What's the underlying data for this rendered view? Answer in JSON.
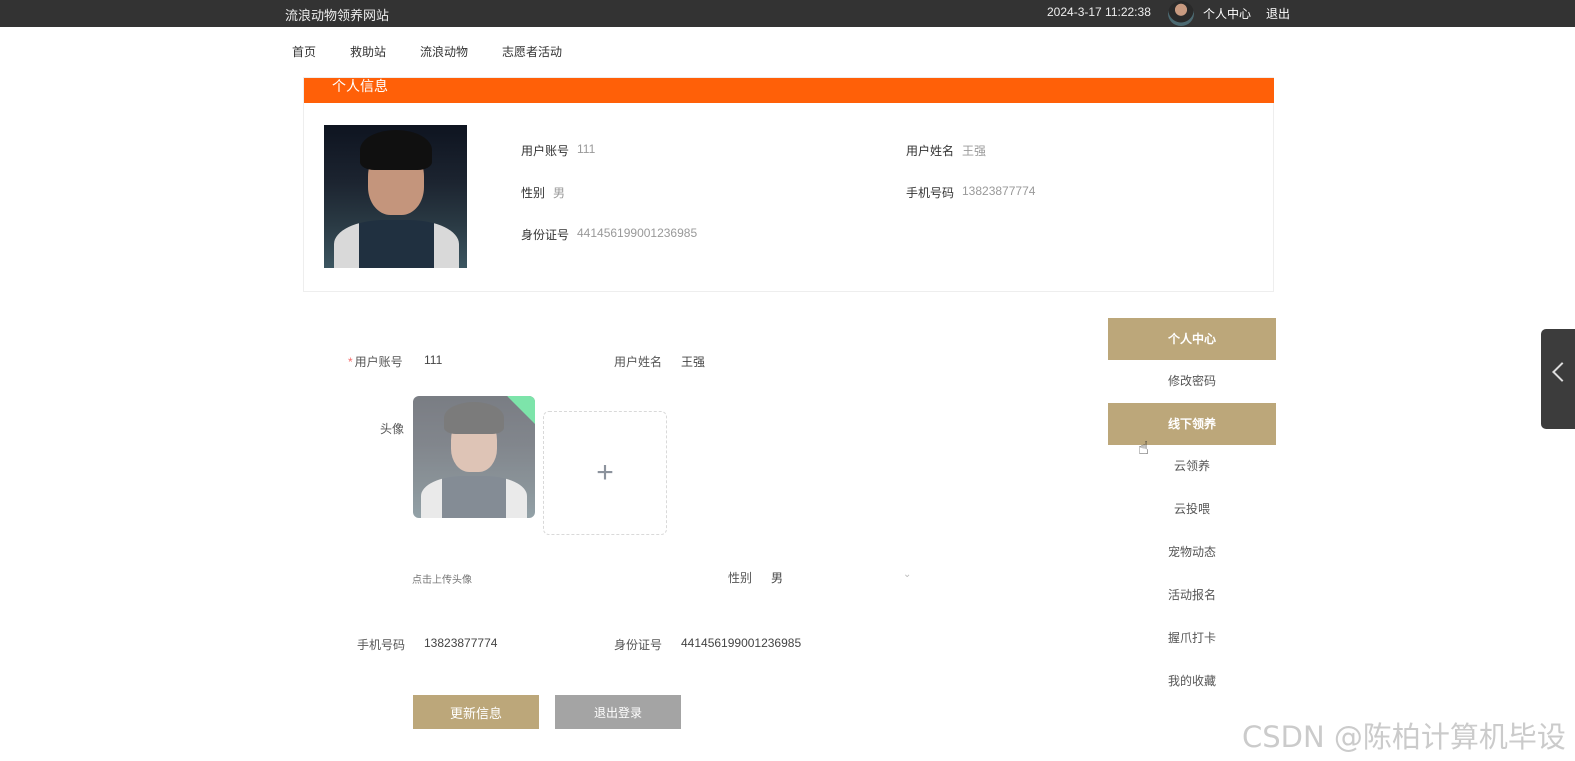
{
  "topbar": {
    "site_title": "流浪动物领养网站",
    "datetime": "2024-3-17 11:22:38",
    "user_center": "个人中心",
    "logout": "退出"
  },
  "nav": {
    "items": [
      {
        "label": "首页"
      },
      {
        "label": "救助站"
      },
      {
        "label": "流浪动物"
      },
      {
        "label": "志愿者活动"
      }
    ]
  },
  "info_card": {
    "title": "个人信息",
    "fields": {
      "account_label": "用户账号",
      "account_value": "111",
      "name_label": "用户姓名",
      "name_value": "王强",
      "gender_label": "性别",
      "gender_value": "男",
      "phone_label": "手机号码",
      "phone_value": "13823877774",
      "idcard_label": "身份证号",
      "idcard_value": "441456199001236985"
    }
  },
  "form": {
    "account_label": "用户账号",
    "account_value": "111",
    "name_label": "用户姓名",
    "name_value": "王强",
    "avatar_label": "头像",
    "upload_hint": "点击上传头像",
    "upload_plus": "+",
    "gender_label": "性别",
    "gender_value": "男",
    "phone_label": "手机号码",
    "phone_value": "13823877774",
    "idcard_label": "身份证号",
    "idcard_value": "441456199001236985",
    "required_mark": "*",
    "update_button": "更新信息",
    "logout_button": "退出登录"
  },
  "side_menu": {
    "items": [
      {
        "label": "个人中心"
      },
      {
        "label": "修改密码"
      },
      {
        "label": "线下领养"
      },
      {
        "label": "云领养"
      },
      {
        "label": "云投喂"
      },
      {
        "label": "宠物动态"
      },
      {
        "label": "活动报名"
      },
      {
        "label": "握爪打卡"
      },
      {
        "label": "我的收藏"
      }
    ]
  },
  "watermark": "CSDN @陈柏计算机毕设",
  "colors": {
    "topbar": "#333333",
    "header_orange": "#ff6008",
    "accent_gold": "#bca77a",
    "gray_button": "#a4a4a4"
  }
}
